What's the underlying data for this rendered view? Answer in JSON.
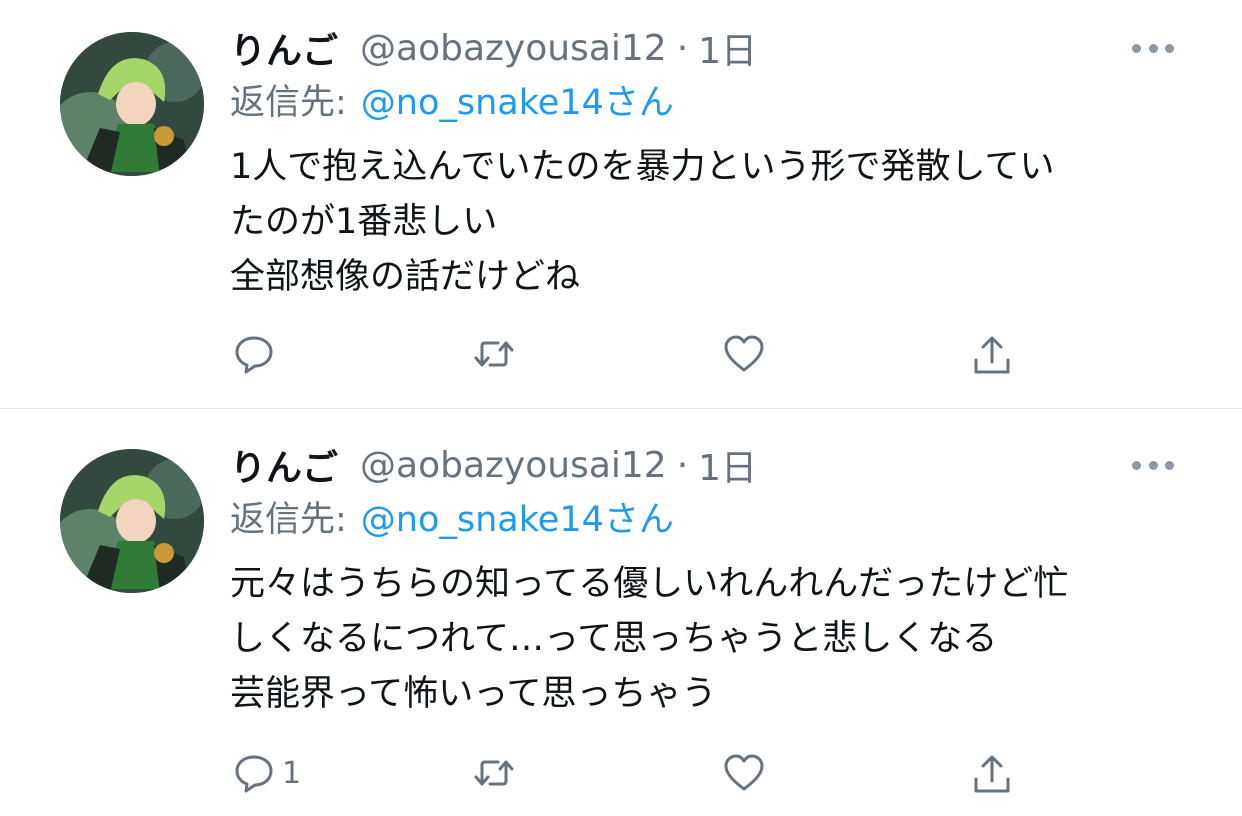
{
  "tweets": [
    {
      "display_name": "りんご",
      "handle": "@aobazyousai12",
      "separator": "·",
      "time": "1日",
      "reply_label": "返信先:",
      "reply_mention": "@no_snake14さん",
      "body_lines": [
        "1人で抱え込んでいたのを暴力という形で発散してい",
        "たのが1番悲しい",
        "全部想像の話だけどね"
      ],
      "reply_count": "",
      "icons": [
        "reply-icon",
        "retweet-icon",
        "like-icon",
        "share-icon",
        "more-icon"
      ]
    },
    {
      "display_name": "りんご",
      "handle": "@aobazyousai12",
      "separator": "·",
      "time": "1日",
      "reply_label": "返信先:",
      "reply_mention": "@no_snake14さん",
      "body_lines": [
        "元々はうちらの知ってる優しいれんれんだったけど忙",
        "しくなるにつれて…って思っちゃうと悲しくなる",
        "芸能界って怖いって思っちゃう"
      ],
      "reply_count": "1",
      "icons": [
        "reply-icon",
        "retweet-icon",
        "like-icon",
        "share-icon",
        "more-icon"
      ]
    }
  ],
  "colors": {
    "text": "#0f1419",
    "secondary": "#66737f",
    "link": "#1d9bf0",
    "divider": "#e3e5e8"
  }
}
